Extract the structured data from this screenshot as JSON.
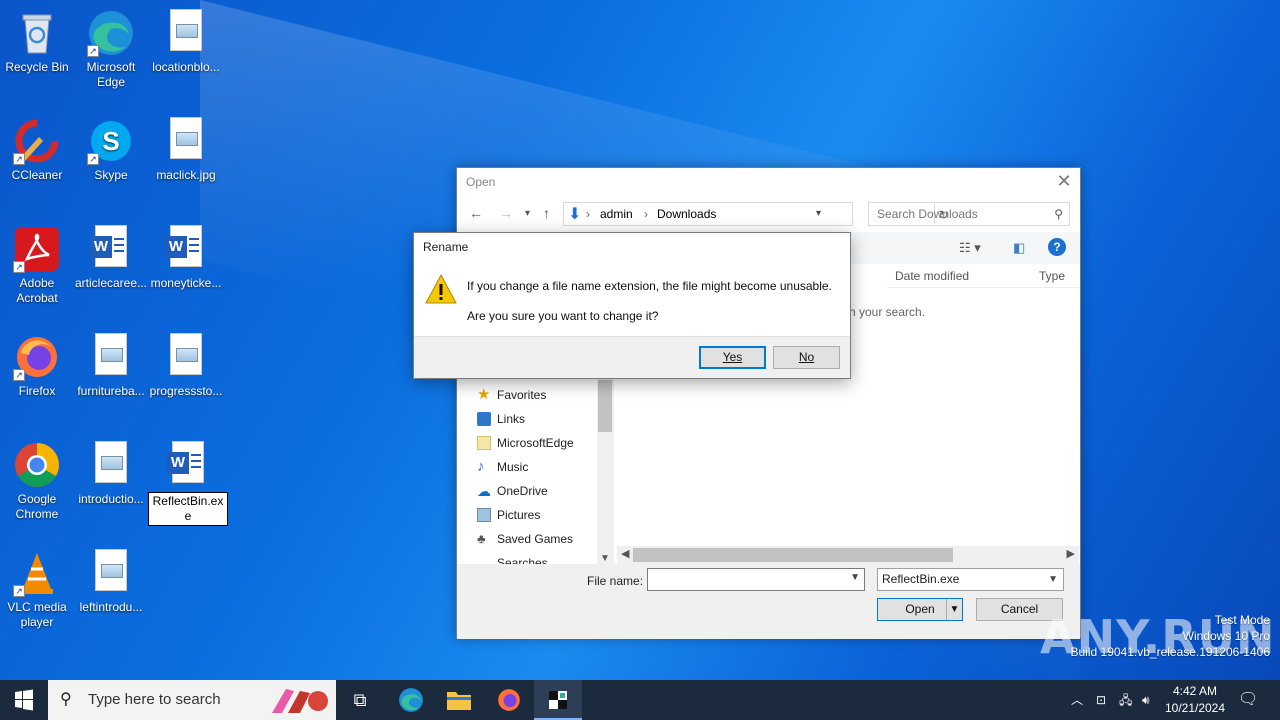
{
  "desktop": {
    "icons": [
      {
        "label": "Recycle Bin"
      },
      {
        "label": "Microsoft Edge"
      },
      {
        "label": "locationblo..."
      },
      {
        "label": "CCleaner"
      },
      {
        "label": "Skype"
      },
      {
        "label": "maclick.jpg"
      },
      {
        "label": "Adobe Acrobat"
      },
      {
        "label": "articlecaree..."
      },
      {
        "label": "moneyticke..."
      },
      {
        "label": "Firefox"
      },
      {
        "label": "furnitureba..."
      },
      {
        "label": "progresssto..."
      },
      {
        "label": "Google Chrome"
      },
      {
        "label": "introductio..."
      },
      {
        "label": "ReflectBin.exe"
      },
      {
        "label": "VLC media player"
      },
      {
        "label": "leftintrodu..."
      }
    ]
  },
  "open_dialog": {
    "title": "Open",
    "breadcrumb": [
      "admin",
      "Downloads"
    ],
    "search_placeholder": "Search Downloads",
    "columns": [
      "Date modified",
      "Type"
    ],
    "empty_message": "h your search.",
    "nav_items": [
      "Favorites",
      "Links",
      "MicrosoftEdge",
      "Music",
      "OneDrive",
      "Pictures",
      "Saved Games",
      "Searches"
    ],
    "file_name_label": "File name:",
    "file_name_value": "",
    "file_type": "ReflectBin.exe",
    "open_label": "Open",
    "cancel_label": "Cancel"
  },
  "rename_dialog": {
    "title": "Rename",
    "message": "If you change a file name extension, the file might become unusable.",
    "question": "Are you sure you want to change it?",
    "yes_label": "Yes",
    "no_label": "No"
  },
  "watermark": {
    "line1": "Test Mode",
    "line2": "Windows 10 Pro",
    "line3": "Build 19041.vb_release.191206-1406",
    "brand": "ANY.RUN"
  },
  "taskbar": {
    "search_placeholder": "Type here to search",
    "time": "4:42 AM",
    "date": "10/21/2024"
  },
  "colors": {
    "accent": "#0078d7",
    "taskbar": "#1c2a3d"
  }
}
